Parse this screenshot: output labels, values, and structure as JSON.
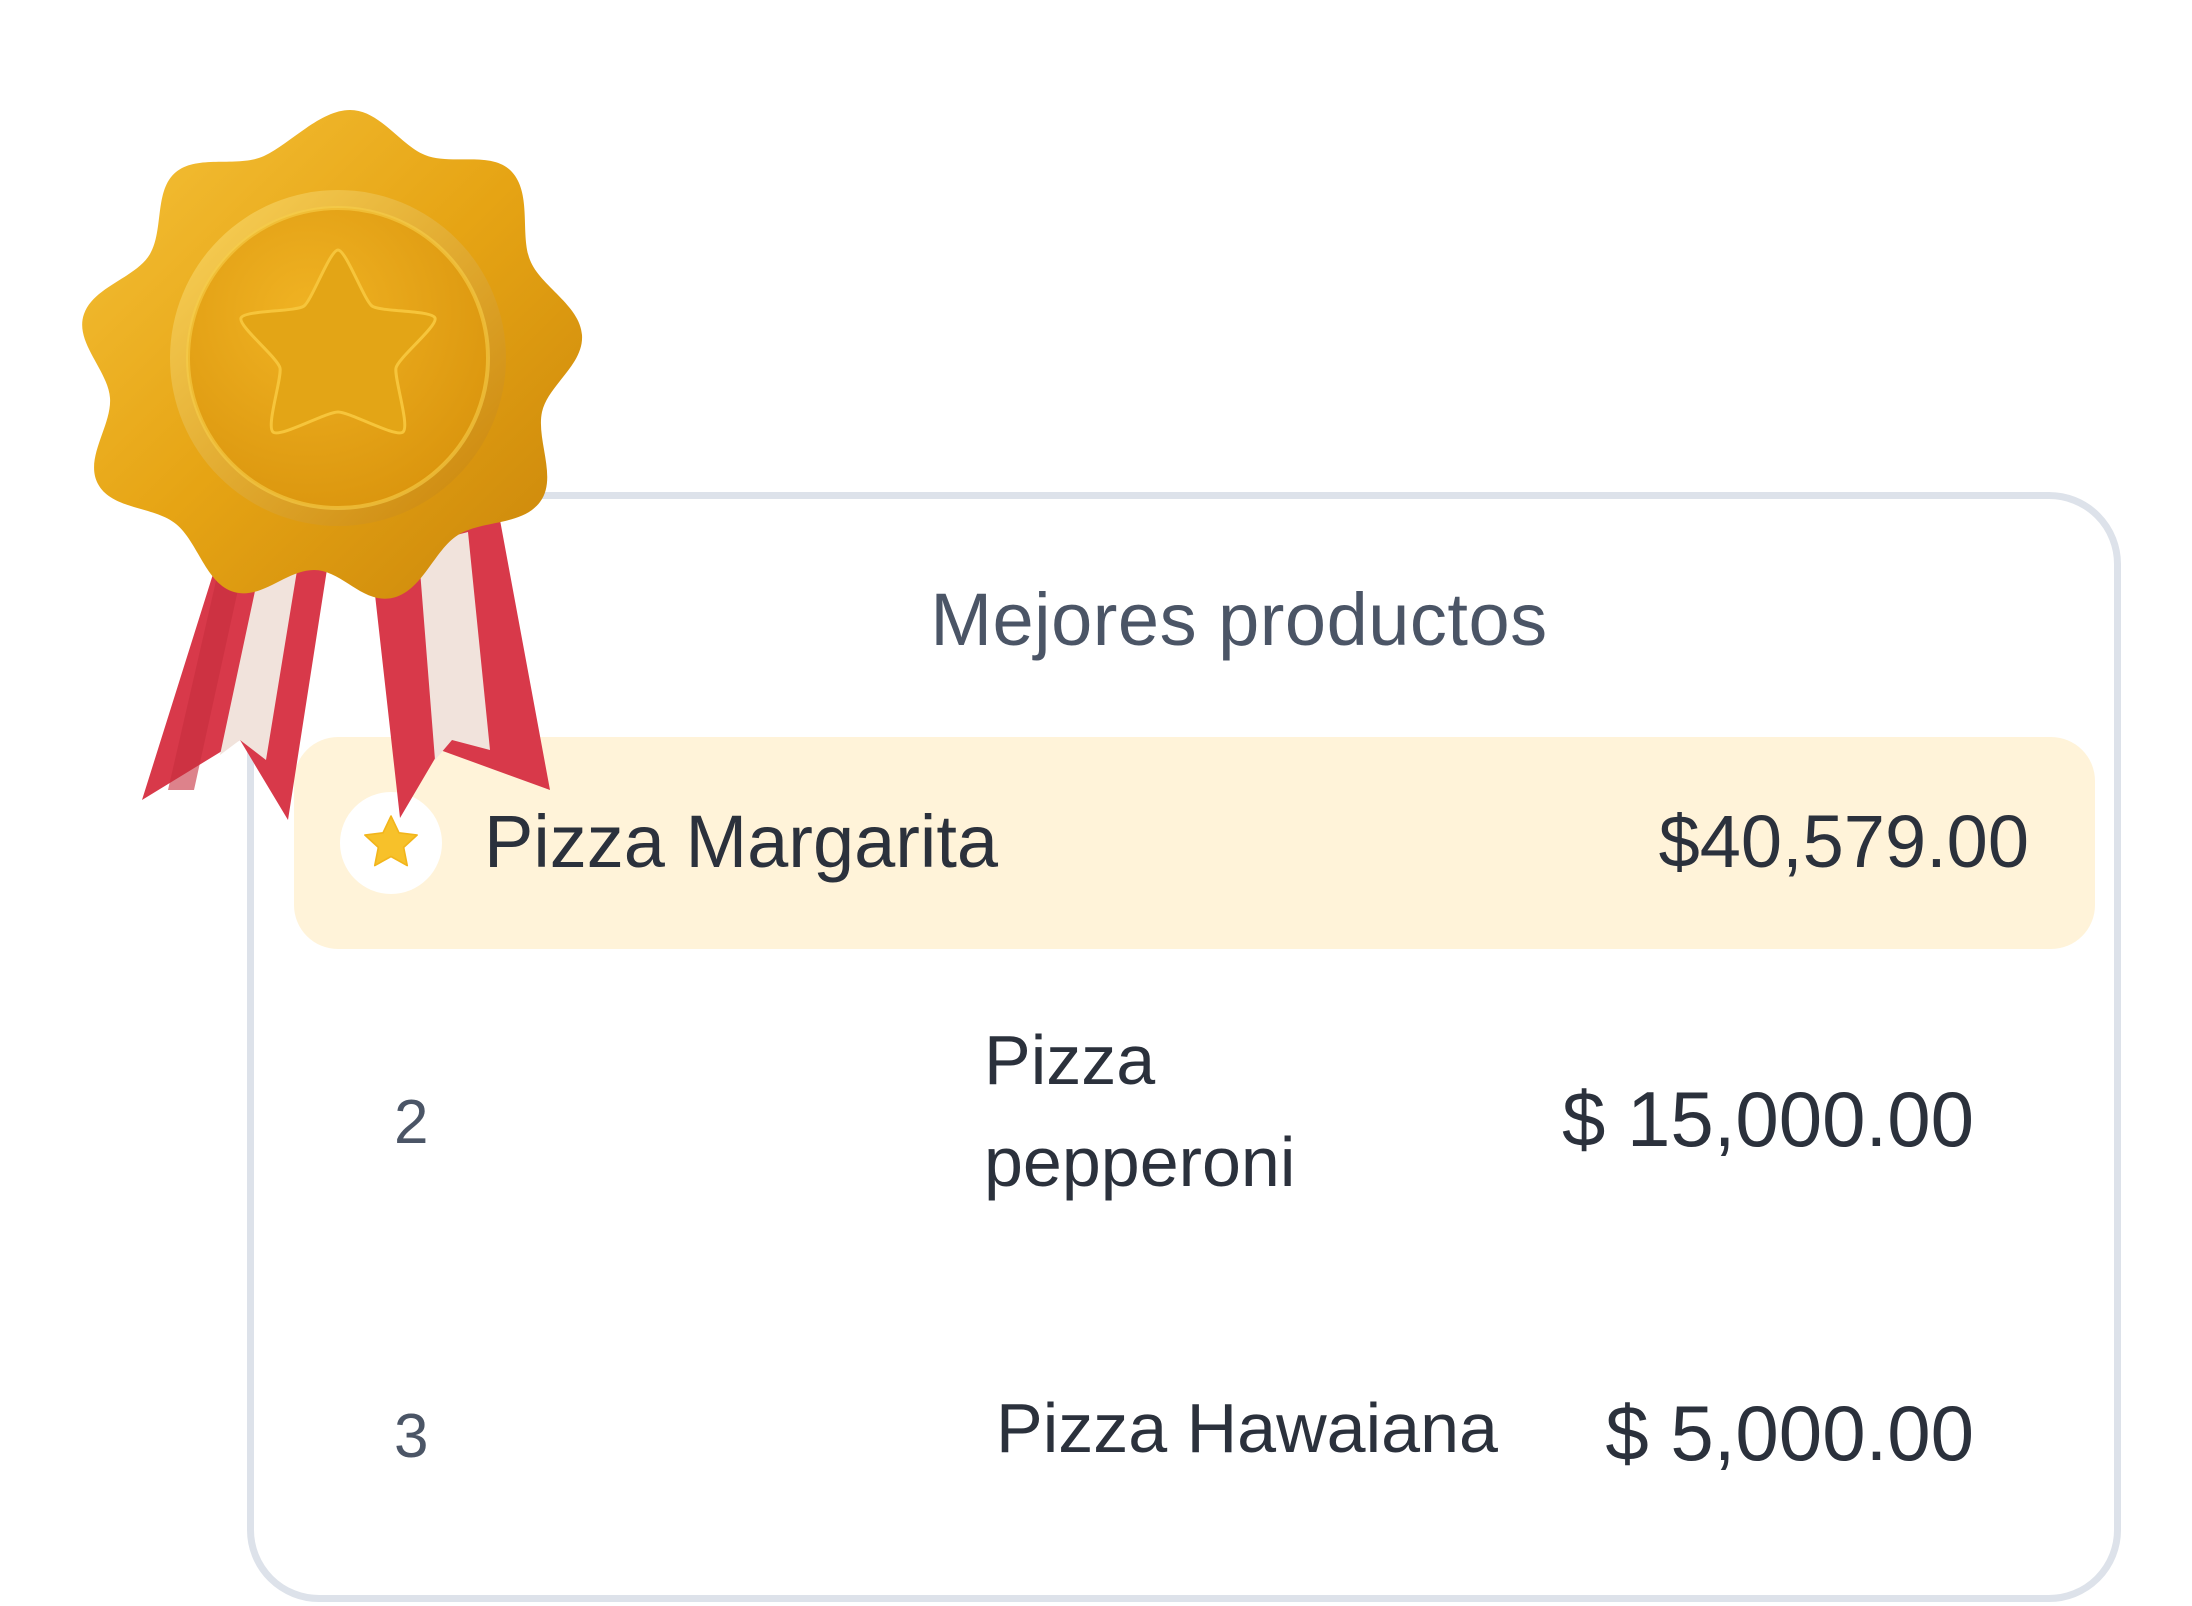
{
  "card": {
    "title": "Mejores productos"
  },
  "top_product": {
    "name": "Pizza Margarita",
    "amount": "$40,579.00"
  },
  "products": [
    {
      "rank": "2",
      "name": "Pizza pepperoni",
      "amount": "$ 15,000.00"
    },
    {
      "rank": "3",
      "name": "Pizza Hawaiana",
      "amount": "$ 5,000.00"
    }
  ],
  "icons": {
    "medal": "gold-star-medal-icon",
    "badge": "star-icon"
  },
  "colors": {
    "highlight": "#fff3d9",
    "gold": "#e9a80f",
    "ribbon_red": "#d93a45",
    "border": "#dde2ea"
  }
}
